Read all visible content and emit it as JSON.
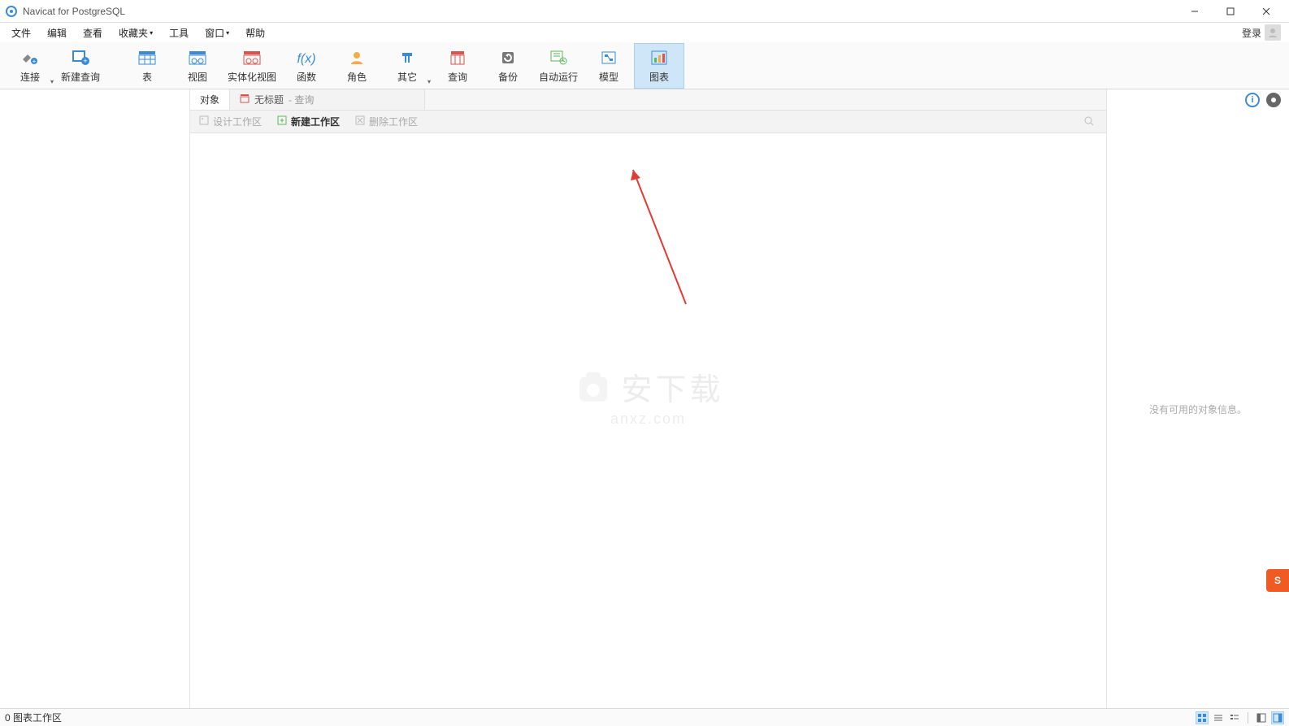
{
  "app": {
    "title": "Navicat for PostgreSQL"
  },
  "menu": {
    "items": [
      "文件",
      "编辑",
      "查看",
      "收藏夹",
      "工具",
      "窗口",
      "帮助"
    ],
    "login": "登录"
  },
  "toolbar": {
    "items": [
      {
        "label": "连接",
        "icon": "plug",
        "dropdown": true
      },
      {
        "label": "新建查询",
        "icon": "new-query"
      },
      {
        "label": "表",
        "icon": "table"
      },
      {
        "label": "视图",
        "icon": "view"
      },
      {
        "label": "实体化视图",
        "icon": "mat-view"
      },
      {
        "label": "函数",
        "icon": "fx"
      },
      {
        "label": "角色",
        "icon": "role"
      },
      {
        "label": "其它",
        "icon": "other",
        "dropdown": true
      },
      {
        "label": "查询",
        "icon": "query"
      },
      {
        "label": "备份",
        "icon": "backup"
      },
      {
        "label": "自动运行",
        "icon": "autorun"
      },
      {
        "label": "模型",
        "icon": "model"
      },
      {
        "label": "图表",
        "icon": "chart",
        "selected": true
      }
    ]
  },
  "tabs": {
    "object": "对象",
    "untitled": "无标题",
    "untitled_suffix": "- 查询"
  },
  "subtool": {
    "design": "设计工作区",
    "new": "新建工作区",
    "delete": "删除工作区"
  },
  "rightpanel": {
    "empty": "没有可用的对象信息。"
  },
  "statusbar": {
    "left": "0 图表工作区"
  },
  "watermark": {
    "top": "安下载",
    "sub": "anxz.com"
  },
  "ime": {
    "label": "S"
  }
}
